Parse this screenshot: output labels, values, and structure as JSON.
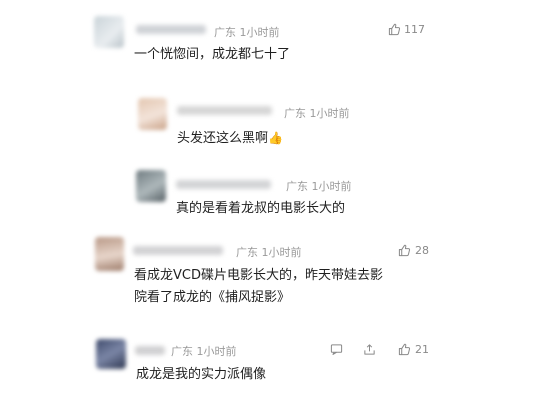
{
  "comments": [
    {
      "location": "广东",
      "time": "1小时前",
      "text": "一个恍惚间，成龙都七十了",
      "likes": "117"
    },
    {
      "location": "广东",
      "time": "1小时前",
      "text": "头发还这么黑啊",
      "emoji": "👍"
    },
    {
      "location": "广东",
      "time": "1小时前",
      "text": "真的是看着龙叔的电影长大的"
    },
    {
      "location": "广东",
      "time": "1小时前",
      "text_line1": "看成龙VCD碟片电影长大的，昨天带娃去影",
      "text_line2": "院看了成龙的《捕风捉影》",
      "likes": "28"
    },
    {
      "location": "广东",
      "time": "1小时前",
      "text": "成龙是我的实力派偶像",
      "likes": "21"
    }
  ],
  "icons": [
    "reply-icon",
    "share-icon",
    "thumbs-up-icon"
  ]
}
